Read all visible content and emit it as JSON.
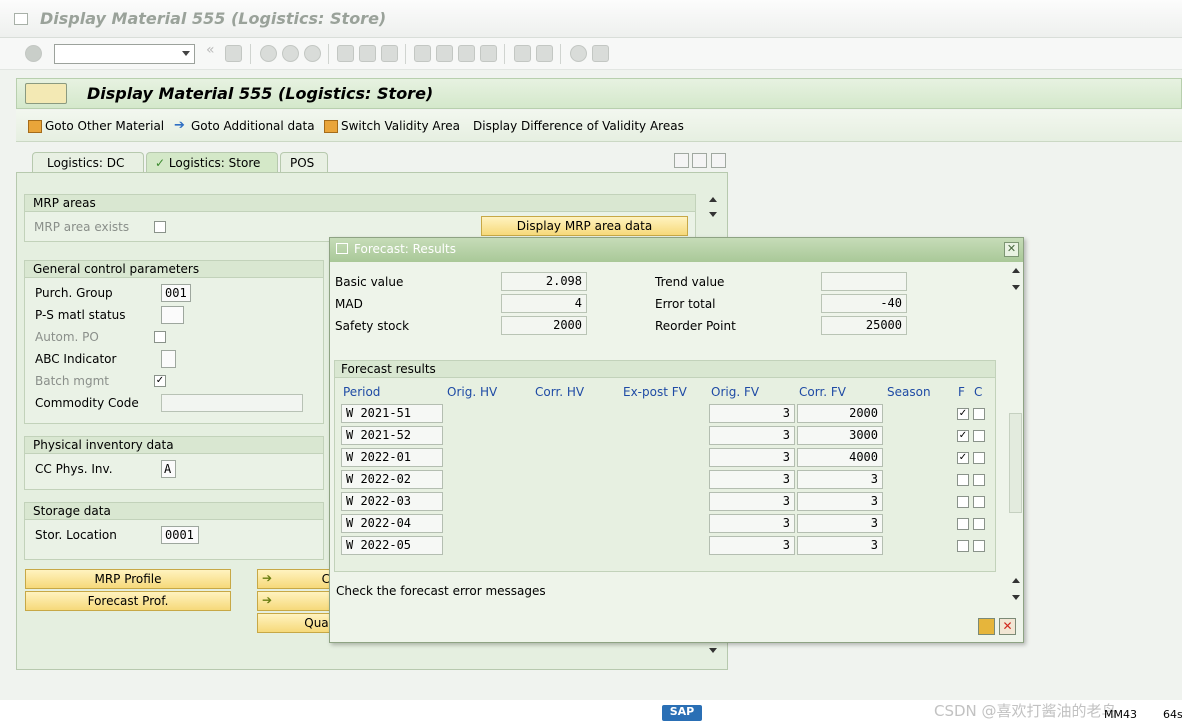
{
  "window": {
    "title": "Display Material 555 (Logistics: Store)"
  },
  "toolbar": {
    "command_value": ""
  },
  "header": {
    "title": "Display Material 555 (Logistics: Store)"
  },
  "app_toolbar": {
    "goto_other": "Goto Other Material",
    "goto_additional": "Goto Additional data",
    "switch_validity": "Switch Validity Area",
    "display_difference": "Display Difference of Validity Areas"
  },
  "tabs": [
    {
      "label": "Logistics: DC"
    },
    {
      "label": "Logistics: Store"
    },
    {
      "label": "POS"
    }
  ],
  "mrp_areas": {
    "title": "MRP areas",
    "exists_label": "MRP area exists",
    "display_button": "Display MRP area data"
  },
  "general": {
    "title": "General control parameters",
    "purch_group_label": "Purch. Group",
    "purch_group_value": "001",
    "ps_status_label": "P-S matl status",
    "autom_po_label": "Autom. PO",
    "abc_label": "ABC Indicator",
    "batch_label": "Batch mgmt",
    "commodity_label": "Commodity Code"
  },
  "physical": {
    "title": "Physical inventory data",
    "cc_label": "CC Phys. Inv.",
    "cc_value": "A"
  },
  "storage": {
    "title": "Storage data",
    "loc_label": "Stor. Location",
    "loc_value": "0001"
  },
  "buttons": {
    "mrp_profile": "MRP Profile",
    "forecast_prof": "Forecast Prof.",
    "c_btn": "C",
    "qual_btn": "Qual"
  },
  "dialog": {
    "title": "Forecast: Results",
    "basic_value_label": "Basic value",
    "basic_value": "2.098",
    "mad_label": "MAD",
    "mad_value": "4",
    "safety_label": "Safety stock",
    "safety_value": "2000",
    "trend_label": "Trend value",
    "trend_value": "",
    "error_label": "Error total",
    "error_value": "-40",
    "reorder_label": "Reorder Point",
    "reorder_value": "25000",
    "results_title": "Forecast results",
    "columns": [
      "Period",
      "Orig. HV",
      "Corr. HV",
      "Ex-post FV",
      "Orig. FV",
      "Corr. FV",
      "Season",
      "F",
      "C"
    ],
    "rows": [
      {
        "period": "W 2021-51",
        "orig_fv": "3",
        "corr_fv": "2000",
        "f": true
      },
      {
        "period": "W 2021-52",
        "orig_fv": "3",
        "corr_fv": "3000",
        "f": true
      },
      {
        "period": "W 2022-01",
        "orig_fv": "3",
        "corr_fv": "4000",
        "f": true
      },
      {
        "period": "W 2022-02",
        "orig_fv": "3",
        "corr_fv": "3",
        "f": false
      },
      {
        "period": "W 2022-03",
        "orig_fv": "3",
        "corr_fv": "3",
        "f": false
      },
      {
        "period": "W 2022-04",
        "orig_fv": "3",
        "corr_fv": "3",
        "f": false
      },
      {
        "period": "W 2022-05",
        "orig_fv": "3",
        "corr_fv": "3",
        "f": false
      }
    ],
    "message": "Check the forecast error messages"
  },
  "status": {
    "transaction": "MM43",
    "time": "64s"
  },
  "watermark": "CSDN @喜欢打酱油的老鸟"
}
